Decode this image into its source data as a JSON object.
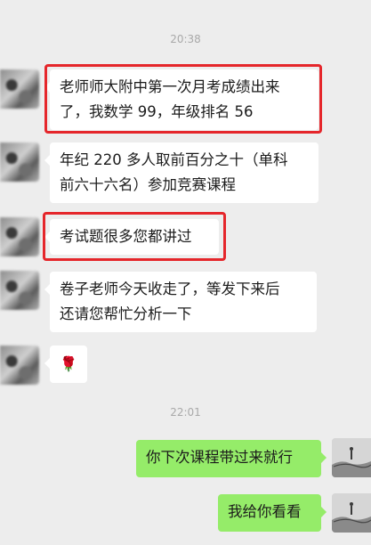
{
  "timestamps": [
    "20:38",
    "22:01"
  ],
  "messages": {
    "m1_line1": "老师师大附中第一次月考成绩出来",
    "m1_line2": "了，我数学 99，年级排名 56",
    "m2_line1": "年纪 220 多人取前百分之十（单科",
    "m2_line2": "前六十六名）参加竞赛课程",
    "m3": "考试题很多您都讲过",
    "m4_line1": "卷子老师今天收走了，等发下来后",
    "m4_line2": "还请您帮忙分析一下",
    "m5_emoji": "🌹",
    "m6": "你下次课程带过来就行",
    "m7": "我给你看看"
  },
  "colors": {
    "background": "#ededed",
    "incoming_bubble": "#ffffff",
    "outgoing_bubble": "#95ec69",
    "highlight": "#e5262b"
  },
  "icons": {
    "rose": "rose-emoji",
    "avatar_contact": "blurred-avatar",
    "avatar_self": "landscape-avatar"
  }
}
